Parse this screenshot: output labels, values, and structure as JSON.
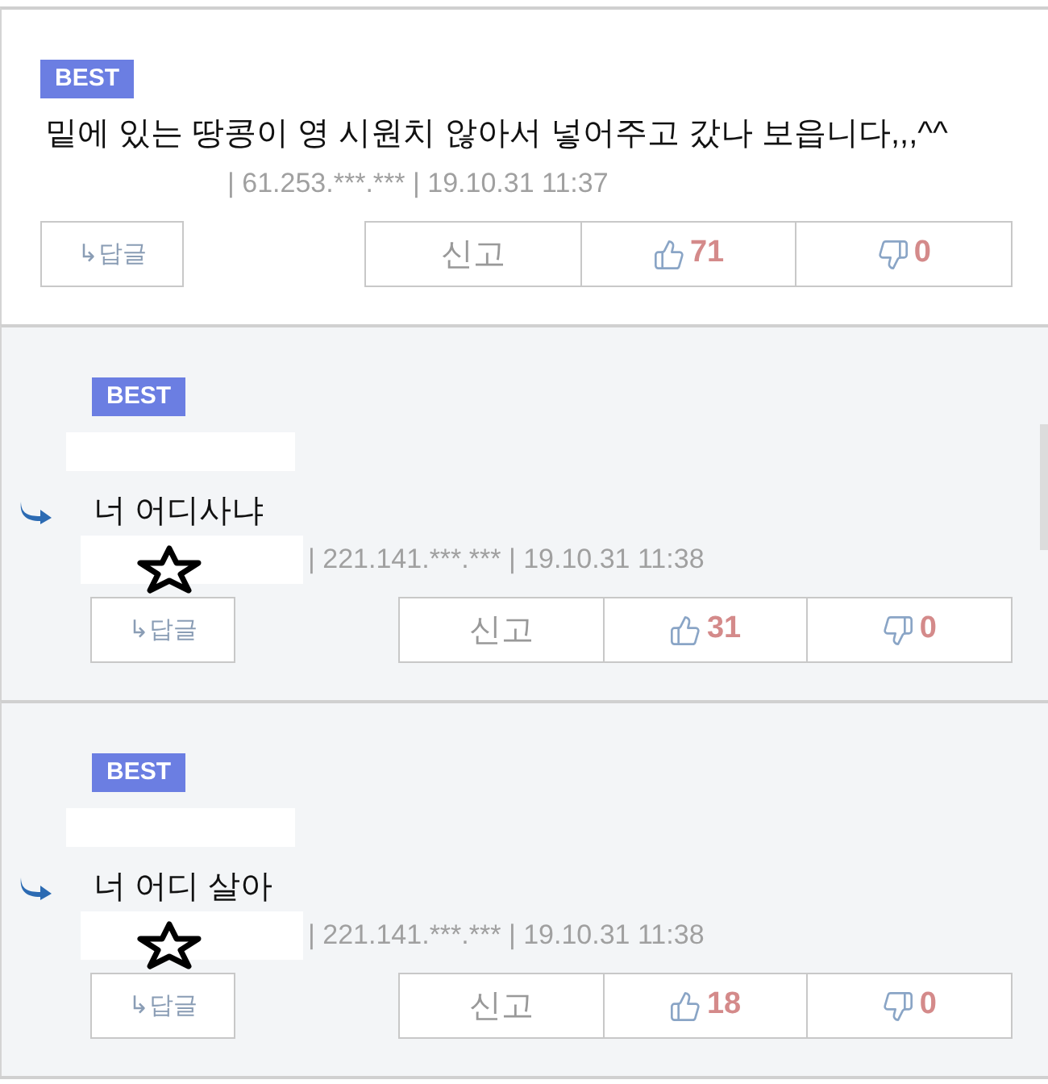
{
  "comments": [
    {
      "kind": "comment",
      "badge": "BEST",
      "text": "밑에 있는 땅콩이 영 시원치 않아서 넣어주고 갔나 보읍니다,,,^^",
      "meta": "| 61.253.***.*** | 19.10.31 11:37",
      "reply_button": "↳답글",
      "report_button": "신고",
      "likes": "71",
      "dislikes": "0"
    },
    {
      "kind": "reply",
      "badge": "BEST",
      "text": "너 어디사냐",
      "meta": "| 221.141.***.*** | 19.10.31 11:38",
      "reply_button": "↳답글",
      "report_button": "신고",
      "likes": "31",
      "dislikes": "0"
    },
    {
      "kind": "reply",
      "badge": "BEST",
      "text": "너 어디 살아",
      "meta": "| 221.141.***.*** | 19.10.31 11:38",
      "reply_button": "↳답글",
      "report_button": "신고",
      "likes": "18",
      "dislikes": "0"
    }
  ]
}
